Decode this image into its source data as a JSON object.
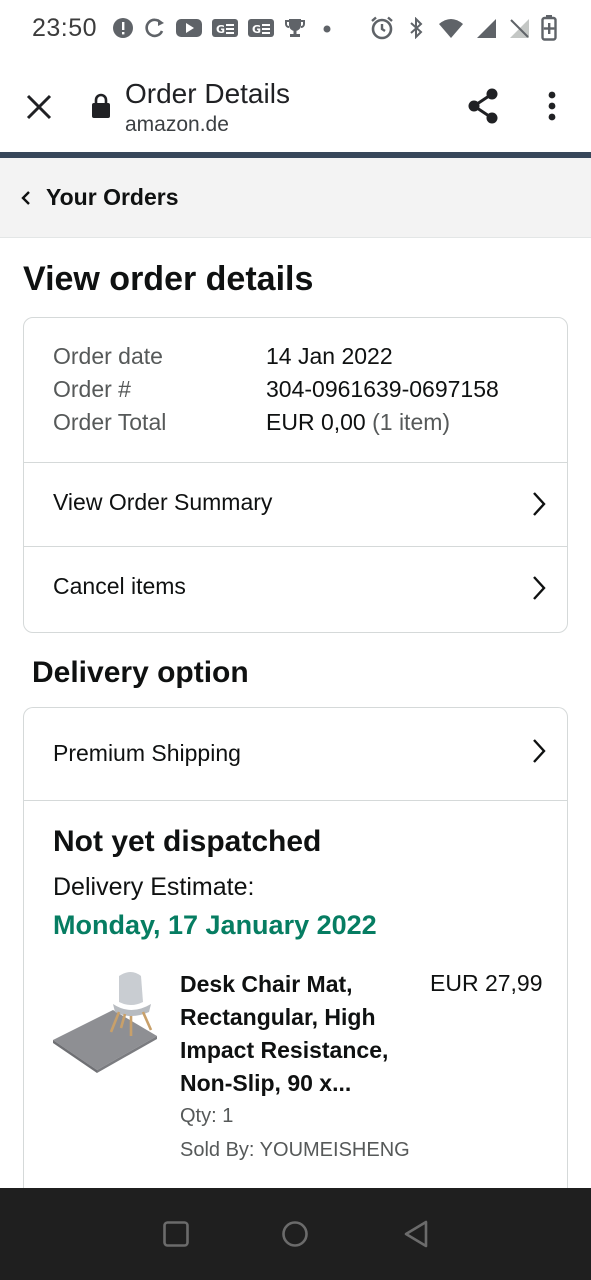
{
  "status_bar": {
    "time": "23:50",
    "left_icons": [
      "alert-circle-icon",
      "sync-icon",
      "youtube-icon",
      "news-icon",
      "news-icon",
      "trophy-icon",
      "dot-icon"
    ],
    "right_icons": [
      "alarm-icon",
      "bluetooth-icon",
      "wifi-icon",
      "signal-icon",
      "no-sim-icon",
      "battery-charging-icon"
    ]
  },
  "browser": {
    "title": "Order Details",
    "domain": "amazon.de"
  },
  "nav": {
    "back_label": "Your Orders"
  },
  "main": {
    "heading": "View order details",
    "order_info": {
      "date_label": "Order date",
      "date_value": "14 Jan 2022",
      "number_label": "Order #",
      "number_value": "304-0961639-0697158",
      "total_label": "Order Total",
      "total_value": "EUR 0,00",
      "total_items": "(1 item)"
    },
    "summary_link": "View Order Summary",
    "cancel_link": "Cancel items"
  },
  "delivery": {
    "heading": "Delivery option",
    "shipping_option": "Premium Shipping",
    "status": "Not yet dispatched",
    "estimate_label": "Delivery Estimate:",
    "estimate_date": "Monday, 17 January 2022",
    "accent_color": "#067d62"
  },
  "product": {
    "title": "Desk Chair Mat, Rectangular, High Impact Resistance, Non-Slip, 90 x...",
    "price": "EUR 27,99",
    "qty": "Qty: 1",
    "seller": "Sold By: YOUMEISHENG"
  },
  "system_nav": {
    "buttons": [
      "recents-square-icon",
      "home-circle-icon",
      "back-triangle-icon"
    ]
  }
}
